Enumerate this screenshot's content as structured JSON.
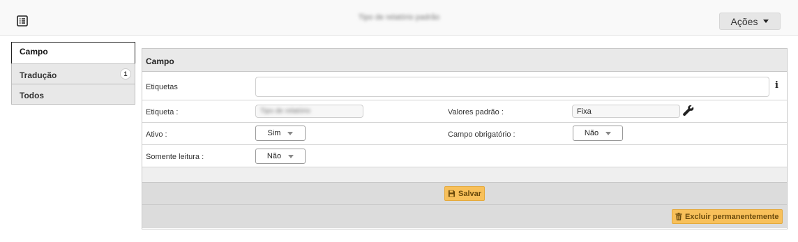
{
  "header": {
    "title": "Tipo de relatório padrão",
    "actions_label": "Ações"
  },
  "tabs": [
    {
      "label": "Campo",
      "active": true,
      "badge": ""
    },
    {
      "label": "Tradução",
      "active": false,
      "badge": "1"
    },
    {
      "label": "Todos",
      "active": false,
      "badge": ""
    }
  ],
  "panel": {
    "title": "Campo",
    "etiquetas_label": "Etiquetas",
    "etiquetas_value": "",
    "etiqueta_label": "Etiqueta :",
    "etiqueta_value": "Tipo de relatório",
    "valores_padrao_label": "Valores padrão :",
    "valores_padrao_value": "Fixa",
    "ativo_label": "Ativo :",
    "ativo_value": "Sim",
    "campo_obrigatorio_label": "Campo obrigatório :",
    "campo_obrigatorio_value": "Não",
    "somente_leitura_label": "Somente leitura :",
    "somente_leitura_value": "Não",
    "save_label": "Salvar",
    "delete_label": "Excluir permanentemente"
  },
  "colors": {
    "button_yellow": "#f8c05a",
    "footer_gray": "#dcdcdc",
    "header_gray": "#e9e9e9"
  }
}
